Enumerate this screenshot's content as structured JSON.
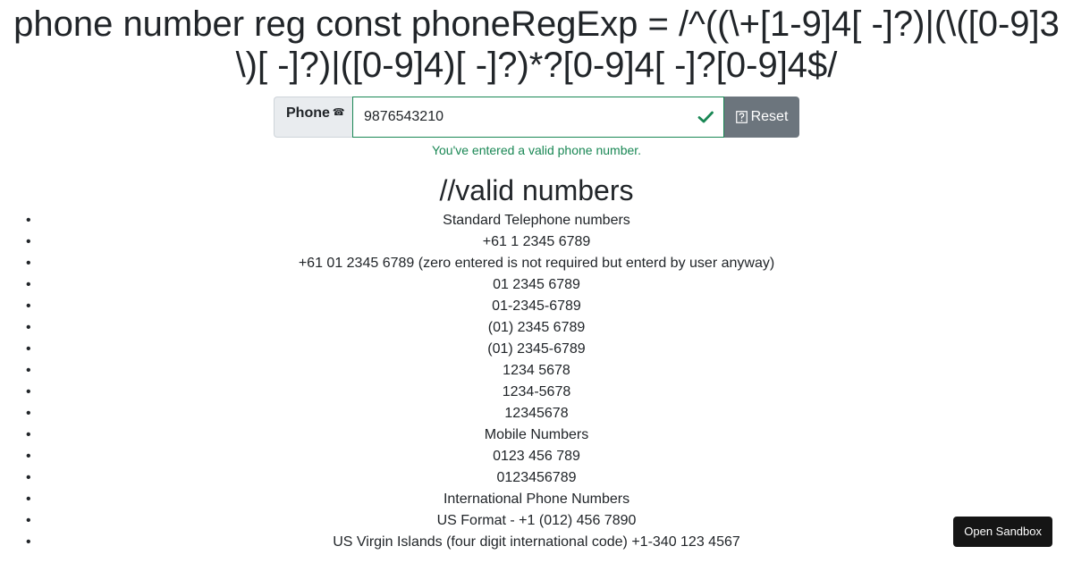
{
  "heading": "phone number reg const phoneRegExp = /^((\\+[1-9]4[ -]?)|(\\([0-9]3\\)[ -]?)|([0-9]4)[ -]?)*?[0-9]4[ -]?[0-9]4$/",
  "form": {
    "phone_label": "Phone",
    "phone_glyph": "☎",
    "phone_value": "9876543210",
    "reset_label": "Reset",
    "feedback": "You've entered a valid phone number."
  },
  "section_title": "//valid numbers",
  "valid_numbers": [
    "Standard Telephone numbers",
    "+61 1 2345 6789",
    "+61 01 2345 6789 (zero entered is not required but enterd by user anyway)",
    "01 2345 6789",
    "01-2345-6789",
    "(01) 2345 6789",
    "(01) 2345-6789",
    "1234 5678",
    "1234-5678",
    "12345678",
    "Mobile Numbers",
    "0123 456 789",
    "0123456789",
    "International Phone Numbers",
    "US Format - +1 (012) 456 7890",
    "US Virgin Islands (four digit international code) +1-340 123 4567"
  ],
  "sandbox_button": "Open Sandbox",
  "colors": {
    "valid": "#198754",
    "reset_button": "#6c757d",
    "sandbox_button": "#151515"
  }
}
